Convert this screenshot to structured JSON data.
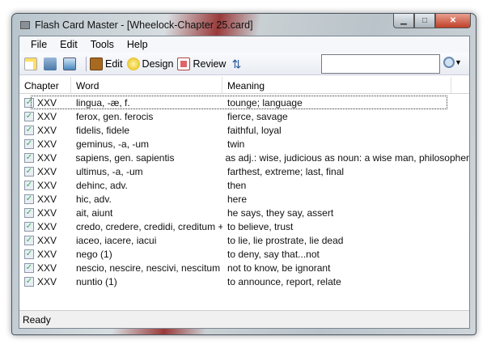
{
  "window": {
    "title": "Flash Card Master - [Wheelock-Chapter 25.card]"
  },
  "menu": [
    "File",
    "Edit",
    "Tools",
    "Help"
  ],
  "toolbar": {
    "edit": "Edit",
    "design": "Design",
    "review": "Review",
    "search_value": ""
  },
  "columns": [
    "Chapter",
    "Word",
    "Meaning"
  ],
  "rows": [
    {
      "chapter": "XXV",
      "word": "lingua, -æ, f.",
      "meaning": "tounge; language"
    },
    {
      "chapter": "XXV",
      "word": "ferox, gen. ferocis",
      "meaning": "fierce, savage"
    },
    {
      "chapter": "XXV",
      "word": "fidelis, fidele",
      "meaning": "faithful, loyal"
    },
    {
      "chapter": "XXV",
      "word": "geminus, -a, -um",
      "meaning": "twin"
    },
    {
      "chapter": "XXV",
      "word": "sapiens, gen. sapientis",
      "meaning": "as adj.: wise, judicious as noun: a wise man, philosopher"
    },
    {
      "chapter": "XXV",
      "word": "ultimus, -a, -um",
      "meaning": "farthest, extreme; last, final"
    },
    {
      "chapter": "XXV",
      "word": "dehinc, adv.",
      "meaning": "then"
    },
    {
      "chapter": "XXV",
      "word": "hic, adv.",
      "meaning": "here"
    },
    {
      "chapter": "XXV",
      "word": "ait, aiunt",
      "meaning": "he says, they say, assert"
    },
    {
      "chapter": "XXV",
      "word": "credo, credere, credidi, creditum + ...",
      "meaning": "to believe, trust"
    },
    {
      "chapter": "XXV",
      "word": "iaceo, iacere, iacui",
      "meaning": "to lie, lie prostrate, lie dead"
    },
    {
      "chapter": "XXV",
      "word": "nego (1)",
      "meaning": "to deny, say that...not"
    },
    {
      "chapter": "XXV",
      "word": "nescio, nescire, nescivi, nescitum",
      "meaning": "not to know, be ignorant"
    },
    {
      "chapter": "XXV",
      "word": "nuntio (1)",
      "meaning": "to announce, report, relate"
    }
  ],
  "status": "Ready"
}
